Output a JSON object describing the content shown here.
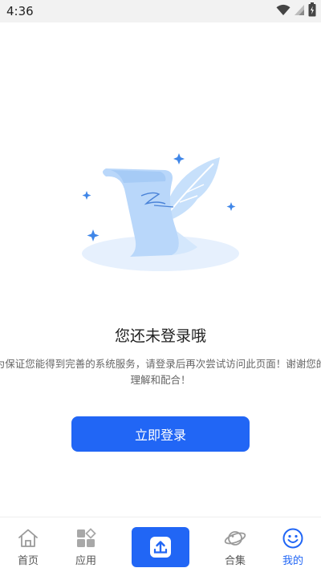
{
  "status_bar": {
    "time": "4:36",
    "icons": [
      "wifi-icon",
      "signal-icon",
      "battery-icon"
    ]
  },
  "empty_state": {
    "title": "您还未登录哦",
    "description": "为保证您能得到完善的系统服务，请登录后再次尝试访问此页面！谢谢您的理解和配合！",
    "illustration_icon": "scroll-quill-icon"
  },
  "login_button": {
    "label": "立即登录"
  },
  "tab_bar": {
    "tabs": [
      {
        "label": "首页",
        "icon": "home-icon"
      },
      {
        "label": "应用",
        "icon": "apps-grid-icon"
      },
      {
        "label": "",
        "icon": "upload-icon"
      },
      {
        "label": "合集",
        "icon": "planet-icon"
      },
      {
        "label": "我的",
        "icon": "smiley-icon",
        "active": true
      }
    ]
  },
  "colors": {
    "accent": "#2166f5",
    "status_bar_bg": "#f2f2f2",
    "text_primary": "#1f1f1f",
    "text_secondary": "#666666"
  }
}
